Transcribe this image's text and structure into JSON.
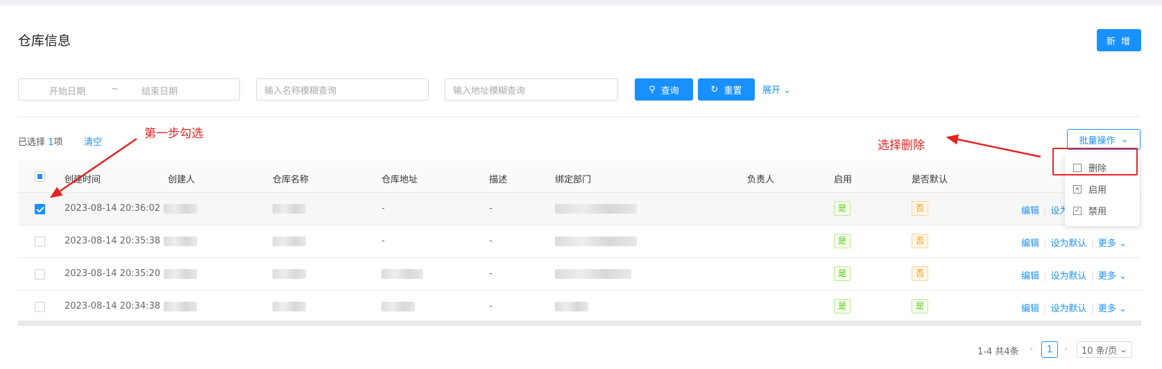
{
  "page": {
    "title": "仓库信息",
    "new_button": "新 增"
  },
  "filters": {
    "start_date_placeholder": "开始日期",
    "date_separator": "~",
    "end_date_placeholder": "结束日期",
    "name_placeholder": "输入名称模糊查询",
    "address_placeholder": "输入地址模糊查询",
    "search_button": "查询",
    "reset_button": "重置",
    "expand_link": "展开"
  },
  "selection": {
    "prefix": "已选择 ",
    "count": "1",
    "suffix": "项",
    "clear": "清空"
  },
  "batch": {
    "button": "批量操作",
    "menu": [
      {
        "label": "删除",
        "icon": "trash-icon"
      },
      {
        "label": "启用",
        "icon": "enable-icon"
      },
      {
        "label": "禁用",
        "icon": "disable-icon"
      }
    ]
  },
  "annotations": {
    "step1": "第一步勾选",
    "step2": "选择删除"
  },
  "table": {
    "columns": [
      "创建时间",
      "创建人",
      "仓库名称",
      "仓库地址",
      "描述",
      "绑定部门",
      "负责人",
      "启用",
      "是否默认"
    ],
    "rows": [
      {
        "checked": true,
        "time": "2023-08-14 20:36:02",
        "address": "-",
        "desc": "-",
        "enabled": "是",
        "default": "否",
        "actions": [
          "编辑",
          "设为默认"
        ]
      },
      {
        "checked": false,
        "time": "2023-08-14 20:35:38",
        "address": "-",
        "desc": "-",
        "enabled": "是",
        "default": "否",
        "actions": [
          "编辑",
          "设为默认",
          "更多"
        ]
      },
      {
        "checked": false,
        "time": "2023-08-14 20:35:20",
        "address": "",
        "desc": "-",
        "enabled": "是",
        "default": "否",
        "actions": [
          "编辑",
          "设为默认",
          "更多"
        ]
      },
      {
        "checked": false,
        "time": "2023-08-14 20:34:38",
        "address": "",
        "desc": "-",
        "enabled": "是",
        "default": "是",
        "actions": [
          "编辑",
          "设为默认",
          "更多"
        ]
      }
    ]
  },
  "pagination": {
    "summary": "1-4 共4条",
    "current_page": "1",
    "page_size": "10 条/页"
  },
  "colors": {
    "primary": "#1890ff",
    "annotation_red": "#e52323",
    "tag_green": "#52c41a",
    "tag_orange": "#fa8c16"
  }
}
